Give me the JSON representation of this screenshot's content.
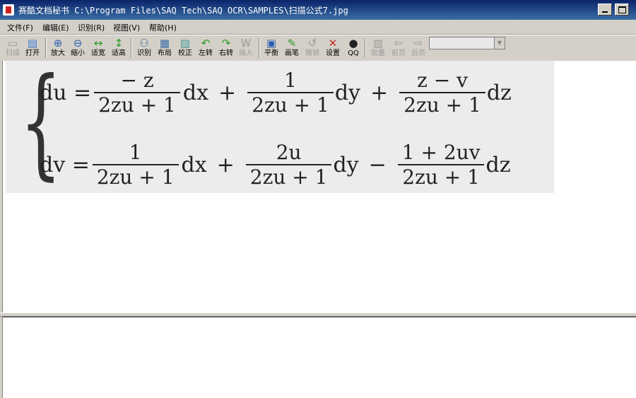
{
  "window": {
    "app_name": "赛酷文档秘书",
    "file_path": "C:\\Program Files\\SAQ Tech\\SAQ OCR\\SAMPLES\\扫描公式7.jpg"
  },
  "menu": [
    {
      "label": "文件(F)"
    },
    {
      "label": "编辑(E)"
    },
    {
      "label": "识别(R)"
    },
    {
      "label": "视图(V)"
    },
    {
      "label": "帮助(H)"
    }
  ],
  "toolbar": {
    "scan": "扫描",
    "open": "打开",
    "zoom_in": "放大",
    "zoom_out": "缩小",
    "fit_width": "适宽",
    "fit_height": "适高",
    "recognize": "识别",
    "layout": "布局",
    "correct": "校正",
    "rotate_left": "左转",
    "rotate_right": "右转",
    "insert": "插入",
    "balance": "平衡",
    "brush": "画笔",
    "undo": "撤销",
    "settings": "设置",
    "qq": "QQ",
    "batch": "批量",
    "prev_page": "前页",
    "next_page": "后页",
    "combo_value": ""
  },
  "formula": {
    "line1": {
      "lhs": "du =",
      "f1_num": "− z",
      "f1_den": "2zu + 1",
      "d1": "dx",
      "op1": "+",
      "f2_num": "1",
      "f2_den": "2zu + 1",
      "d2": "dy",
      "op2": "+",
      "f3_num": "z − v",
      "f3_den": "2zu + 1",
      "d3": "dz"
    },
    "line2": {
      "lhs": "dv =",
      "f1_num": "1",
      "f1_den": "2zu + 1",
      "d1": "dx",
      "op1": "+",
      "f2_num": "2u",
      "f2_den": "2zu + 1",
      "d2": "dy",
      "op2": "−",
      "f3_num": "1 + 2uv",
      "f3_den": "2zu + 1",
      "d3": "dz"
    }
  },
  "colors": {
    "title_bar": "#0a246a",
    "window_face": "#d4d0c8"
  }
}
